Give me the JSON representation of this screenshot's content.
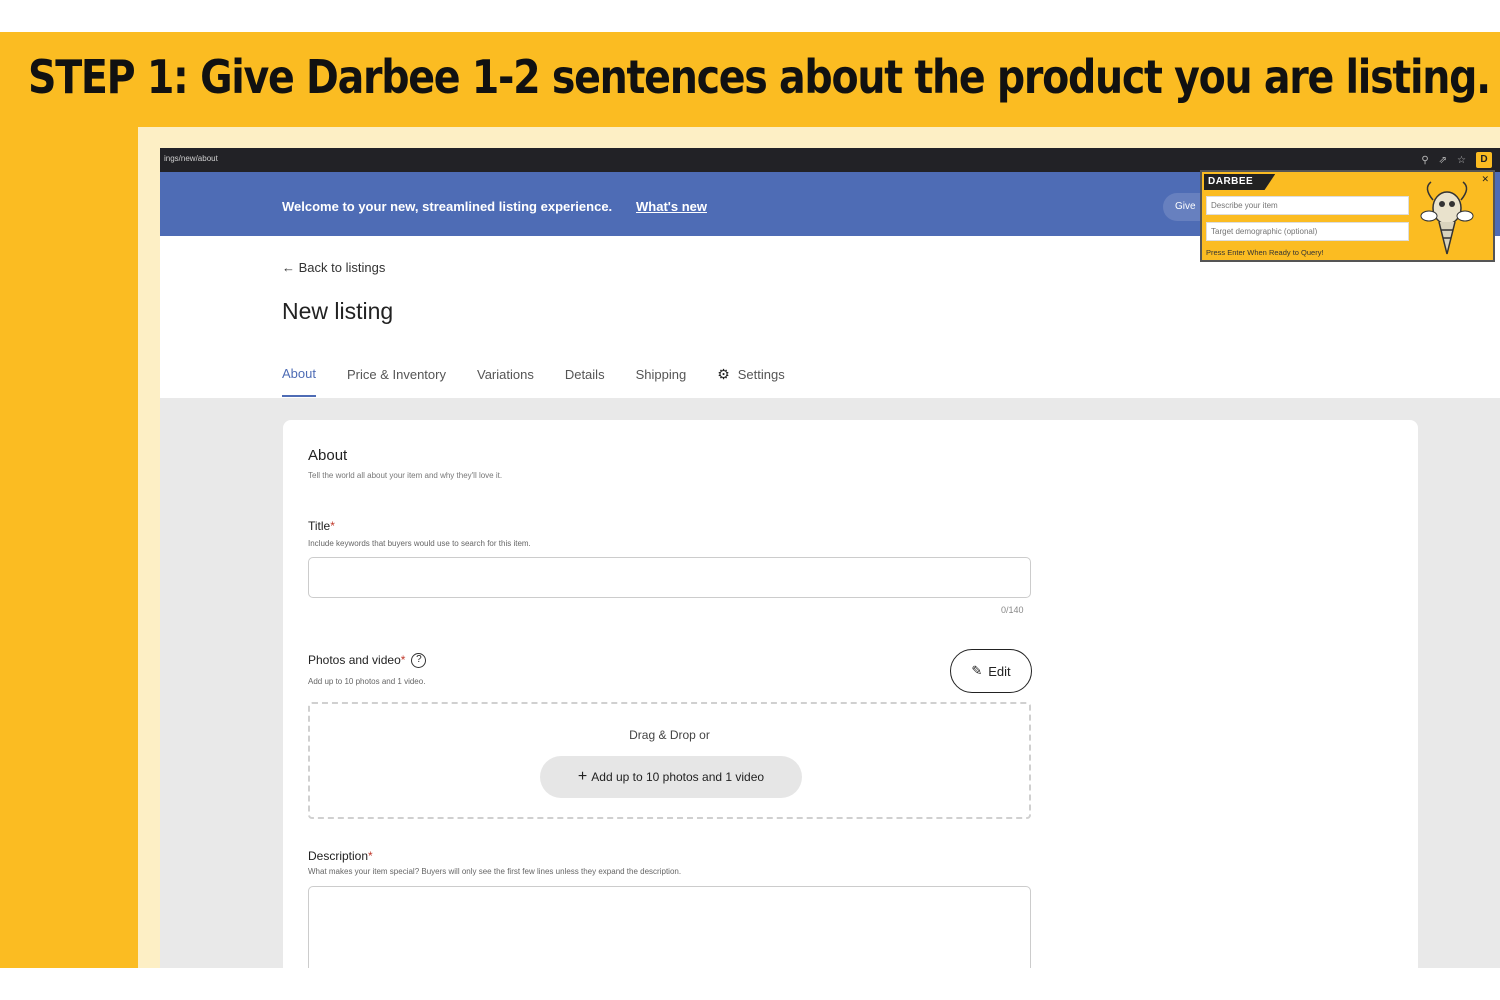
{
  "headline": "STEP 1: Give Darbee 1-2 sentences about the product you are listing.",
  "browser": {
    "url": "ings/new/about"
  },
  "banner": {
    "text": "Welcome to your new, streamlined listing experience.",
    "link": "What's new",
    "button_label": "Give"
  },
  "nav": {
    "back_label": "← Back to listings"
  },
  "page": {
    "title": "New listing"
  },
  "tabs": [
    {
      "label": "About",
      "active": true
    },
    {
      "label": "Price & Inventory"
    },
    {
      "label": "Variations"
    },
    {
      "label": "Details"
    },
    {
      "label": "Shipping"
    },
    {
      "label": "Settings"
    }
  ],
  "about": {
    "title": "About",
    "subtitle": "Tell the world all about your item and why they'll love it."
  },
  "title_field": {
    "label": "Title",
    "required_mark": "*",
    "help": "Include keywords that buyers would use to search for this item.",
    "value": "",
    "counter": "0/140"
  },
  "photos": {
    "label": "Photos and video",
    "required_mark": "*",
    "help_icon": "?",
    "help": "Add up to 10 photos and 1 video.",
    "edit_label": "Edit",
    "drag_text": "Drag & Drop or",
    "add_button": "Add up to 10 photos and 1 video"
  },
  "description": {
    "label": "Description",
    "required_mark": "*",
    "help": "What makes your item special? Buyers will only see the first few lines unless they expand the description.",
    "value": ""
  },
  "darbee": {
    "logo": "DARBEE",
    "close": "✕",
    "describe_placeholder": "Describe your item",
    "demographic_placeholder": "Target demographic (optional)",
    "hint": "Press Enter When Ready to Query!"
  },
  "icons": {
    "search": "search-icon",
    "arrow": "red-arrow-icon",
    "gear": "gear-icon",
    "pencil": "pencil-icon",
    "plus": "plus-icon"
  },
  "colors": {
    "yellow": "#FBBC22",
    "banner_blue": "#4E6CB5",
    "arrow_red": "#E3232A",
    "required_red": "#c0392b"
  }
}
